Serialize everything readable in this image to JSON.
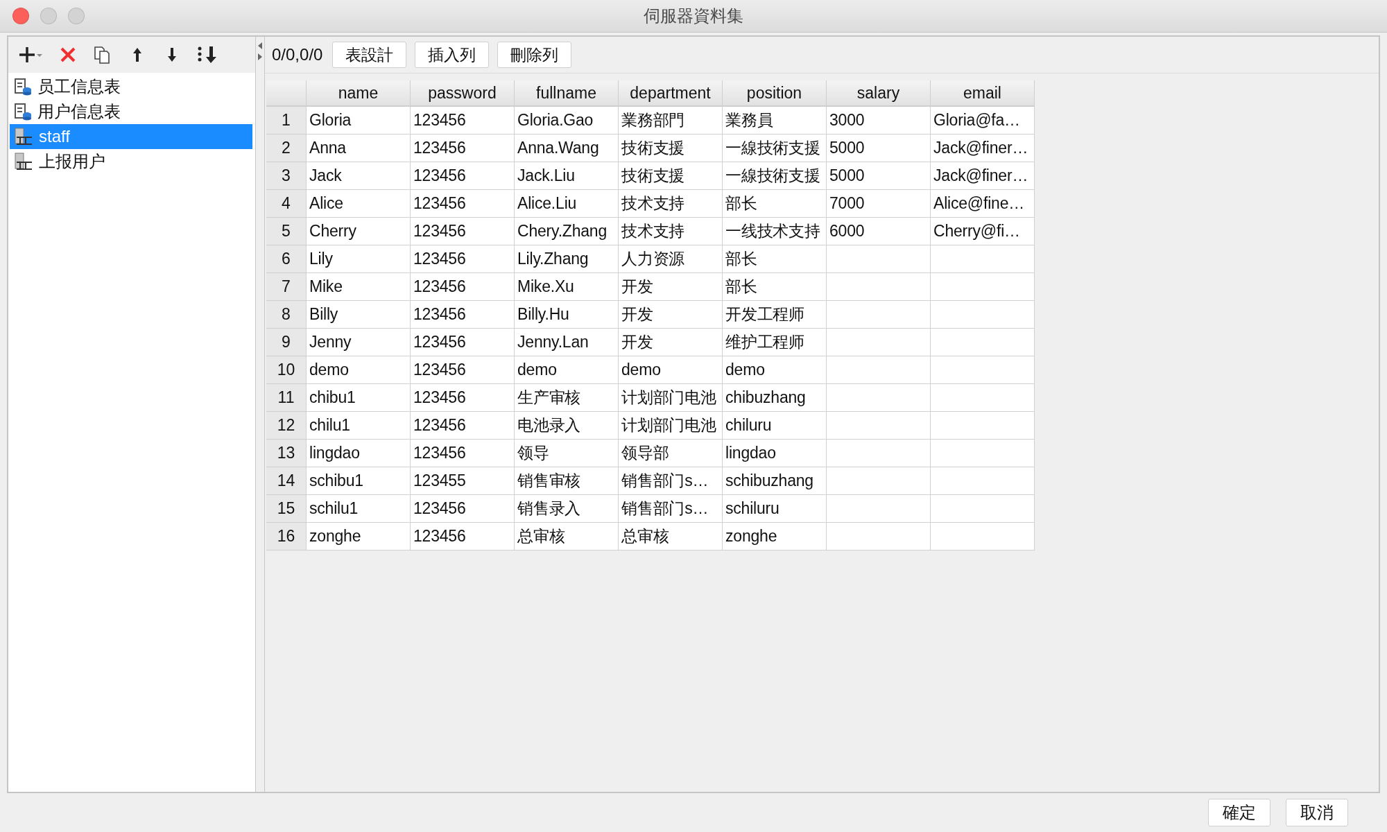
{
  "window": {
    "title": "伺服器資料集"
  },
  "toolbar": {
    "counter": "0/0,0/0",
    "buttons": [
      "表設計",
      "插入列",
      "刪除列"
    ]
  },
  "sidebar": {
    "items": [
      {
        "label": "员工信息表",
        "kind": "sheet",
        "selected": false
      },
      {
        "label": "用户信息表",
        "kind": "sheet",
        "selected": false
      },
      {
        "label": "staff",
        "kind": "grid",
        "selected": true
      },
      {
        "label": "上报用户",
        "kind": "grid",
        "selected": false
      }
    ]
  },
  "table": {
    "columns": [
      "name",
      "password",
      "fullname",
      "department",
      "position",
      "salary",
      "email"
    ],
    "rows": [
      {
        "index": "1",
        "cells": [
          "Gloria",
          "123456",
          "Gloria.Gao",
          "業務部門",
          "業務員",
          "3000",
          "Gloria@fa…"
        ]
      },
      {
        "index": "2",
        "cells": [
          "Anna",
          "123456",
          "Anna.Wang",
          "技術支援",
          "一線技術支援",
          "5000",
          "Jack@finer…"
        ]
      },
      {
        "index": "3",
        "cells": [
          "Jack",
          "123456",
          "Jack.Liu",
          "技術支援",
          "一線技術支援",
          "5000",
          "Jack@finer…"
        ]
      },
      {
        "index": "4",
        "cells": [
          "Alice",
          "123456",
          "Alice.Liu",
          "技术支持",
          "部长",
          "7000",
          "Alice@fine…"
        ]
      },
      {
        "index": "5",
        "cells": [
          "Cherry",
          "123456",
          "Chery.Zhang",
          "技术支持",
          "一线技术支持",
          "6000",
          "Cherry@fi…"
        ]
      },
      {
        "index": "6",
        "cells": [
          "Lily",
          "123456",
          "Lily.Zhang",
          "人力资源",
          "部长",
          "",
          ""
        ]
      },
      {
        "index": "7",
        "cells": [
          "Mike",
          "123456",
          "Mike.Xu",
          "开发",
          "部长",
          "",
          ""
        ]
      },
      {
        "index": "8",
        "cells": [
          "Billy",
          "123456",
          "Billy.Hu",
          "开发",
          "开发工程师",
          "",
          ""
        ]
      },
      {
        "index": "9",
        "cells": [
          "Jenny",
          "123456",
          "Jenny.Lan",
          "开发",
          "维护工程师",
          "",
          ""
        ]
      },
      {
        "index": "10",
        "cells": [
          "demo",
          "123456",
          "demo",
          "demo",
          "demo",
          "",
          ""
        ]
      },
      {
        "index": "11",
        "cells": [
          "chibu1",
          "123456",
          "生产审核",
          "计划部门电池",
          "chibuzhang",
          "",
          ""
        ]
      },
      {
        "index": "12",
        "cells": [
          "chilu1",
          "123456",
          "电池录入",
          "计划部门电池",
          "chiluru",
          "",
          ""
        ]
      },
      {
        "index": "13",
        "cells": [
          "lingdao",
          "123456",
          "领导",
          "领导部",
          "lingdao",
          "",
          ""
        ]
      },
      {
        "index": "14",
        "cells": [
          "schibu1",
          "123455",
          "销售审核",
          "销售部门s…",
          "schibuzhang",
          "",
          ""
        ]
      },
      {
        "index": "15",
        "cells": [
          "schilu1",
          "123456",
          "销售录入",
          "销售部门s…",
          "schiluru",
          "",
          ""
        ]
      },
      {
        "index": "16",
        "cells": [
          "zonghe",
          "123456",
          "总审核",
          "总审核",
          "zonghe",
          "",
          ""
        ]
      }
    ]
  },
  "footer": {
    "buttons": [
      "確定",
      "取消"
    ]
  }
}
